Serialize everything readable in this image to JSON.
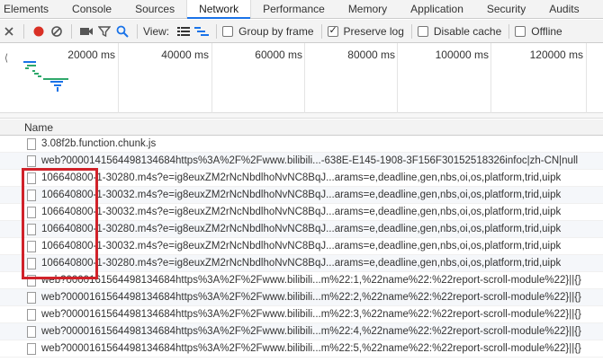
{
  "tabs": [
    {
      "label": "Elements"
    },
    {
      "label": "Console"
    },
    {
      "label": "Sources"
    },
    {
      "label": "Network",
      "active": true
    },
    {
      "label": "Performance"
    },
    {
      "label": "Memory"
    },
    {
      "label": "Application"
    },
    {
      "label": "Security"
    },
    {
      "label": "Audits"
    }
  ],
  "toolbar": {
    "view_label": "View:",
    "group_by_frame": {
      "label": "Group by frame",
      "checked": false
    },
    "preserve_log": {
      "label": "Preserve log",
      "checked": true
    },
    "disable_cache": {
      "label": "Disable cache",
      "checked": false
    },
    "offline": {
      "label": "Offline",
      "checked": false
    },
    "record_color": "#d93025",
    "filter_active_color": "#1a73e8"
  },
  "overview": {
    "ticks": [
      "20000 ms",
      "40000 ms",
      "60000 ms",
      "80000 ms",
      "100000 ms",
      "120000 ms"
    ],
    "colors": {
      "waiting": "#2ea86b",
      "download": "#1a73e8"
    }
  },
  "list": {
    "header": "Name",
    "rows": [
      {
        "name": "3.08f2b.function.chunk.js"
      },
      {
        "name": "web?0000141564498134684https%3A%2F%2Fwww.bilibili...-638E-E145-1908-3F156F30152518326infoc|zh-CN|null"
      },
      {
        "name": "106640800-1-30280.m4s?e=ig8euxZM2rNcNbdlhoNvNC8BqJ...arams=e,deadline,gen,nbs,oi,os,platform,trid,uipk"
      },
      {
        "name": "106640800-1-30032.m4s?e=ig8euxZM2rNcNbdlhoNvNC8BqJ...arams=e,deadline,gen,nbs,oi,os,platform,trid,uipk"
      },
      {
        "name": "106640800-1-30032.m4s?e=ig8euxZM2rNcNbdlhoNvNC8BqJ...arams=e,deadline,gen,nbs,oi,os,platform,trid,uipk"
      },
      {
        "name": "106640800-1-30280.m4s?e=ig8euxZM2rNcNbdlhoNvNC8BqJ...arams=e,deadline,gen,nbs,oi,os,platform,trid,uipk"
      },
      {
        "name": "106640800-1-30032.m4s?e=ig8euxZM2rNcNbdlhoNvNC8BqJ...arams=e,deadline,gen,nbs,oi,os,platform,trid,uipk"
      },
      {
        "name": "106640800-1-30280.m4s?e=ig8euxZM2rNcNbdlhoNvNC8BqJ...arams=e,deadline,gen,nbs,oi,os,platform,trid,uipk"
      },
      {
        "name": "web?0000161564498134684https%3A%2F%2Fwww.bilibili...m%22:1,%22name%22:%22report-scroll-module%22}||{}"
      },
      {
        "name": "web?0000161564498134684https%3A%2F%2Fwww.bilibili...m%22:2,%22name%22:%22report-scroll-module%22}||{}"
      },
      {
        "name": "web?0000161564498134684https%3A%2F%2Fwww.bilibili...m%22:3,%22name%22:%22report-scroll-module%22}||{}"
      },
      {
        "name": "web?0000161564498134684https%3A%2F%2Fwww.bilibili...m%22:4,%22name%22:%22report-scroll-module%22}||{}"
      },
      {
        "name": "web?0000161564498134684https%3A%2F%2Fwww.bilibili...m%22:5,%22name%22:%22report-scroll-module%22}||{}"
      }
    ]
  },
  "highlight_color": "#d0222a"
}
